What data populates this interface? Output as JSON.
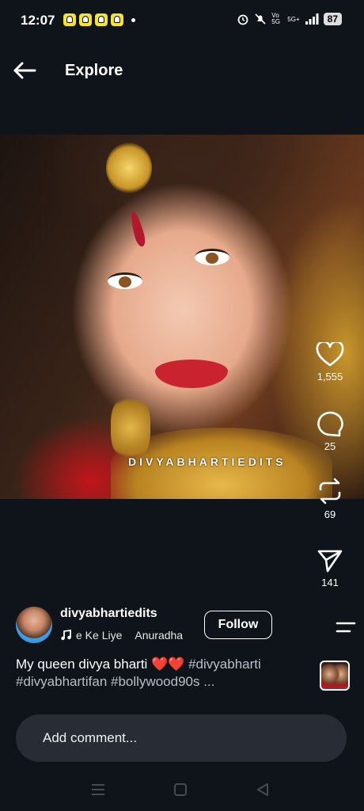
{
  "status_bar": {
    "time": "12:07",
    "network": "Vo 5G",
    "signal_label": "5G+",
    "battery": "87"
  },
  "header": {
    "title": "Explore"
  },
  "post": {
    "watermark": "DIVYABHARTIEDITS",
    "likes": "1,555",
    "comments": "25",
    "reposts": "69",
    "shares": "141",
    "username": "divyabhartiedits",
    "audio_title": "e Ke Liye",
    "audio_artist": "Anuradha",
    "follow_label": "Follow",
    "caption_text": "My queen divya bharti ❤️❤️",
    "caption_tags": " #divyabharti #divyabhartifan #bollywood90s ..."
  },
  "comment": {
    "placeholder": "Add comment..."
  },
  "icons": {
    "back": "arrow-left-icon",
    "like": "heart-icon",
    "comment": "chat-bubble-icon",
    "repost": "repost-icon",
    "share": "send-icon",
    "more": "menu-lines-icon",
    "music": "music-note-icon"
  },
  "colors": {
    "background": "#0f141b",
    "comment_bg": "#272c35",
    "hashtag": "#b8bfc9",
    "snap_yellow": "#f7e52a"
  }
}
